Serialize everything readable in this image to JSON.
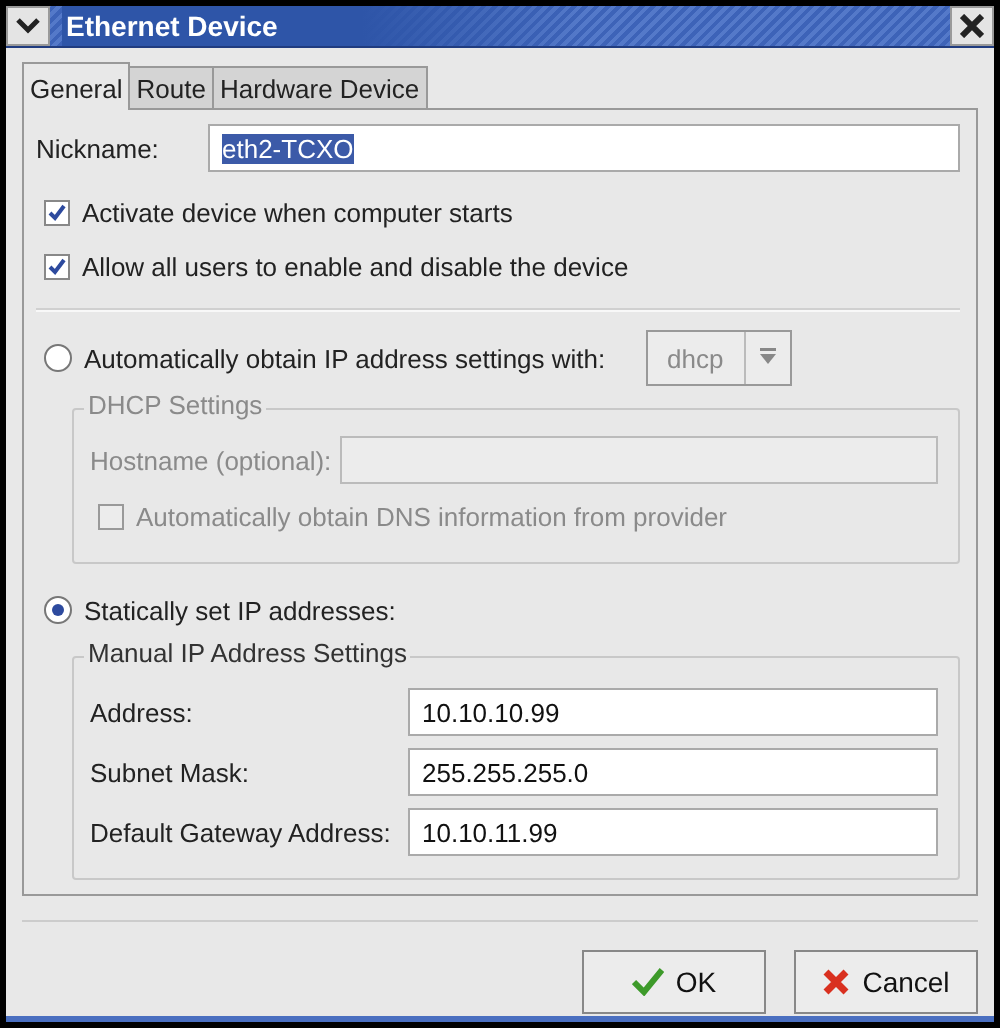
{
  "window": {
    "title": "Ethernet Device"
  },
  "tabs": [
    {
      "label": "General",
      "selected": true
    },
    {
      "label": "Route",
      "selected": false
    },
    {
      "label": "Hardware Device",
      "selected": false
    }
  ],
  "nickname": {
    "label": "Nickname:",
    "value": "eth2-TCXO",
    "text_selected": true
  },
  "options": [
    {
      "label": "Activate device when computer starts",
      "checked": true
    },
    {
      "label": "Allow all users to enable and disable the device",
      "checked": true
    }
  ],
  "automatic": {
    "label": "Automatically obtain IP address settings with:",
    "selected": false,
    "dropdown": {
      "value": "dhcp",
      "disabled": true
    }
  },
  "dhcp_settings": {
    "title": "DHCP Settings",
    "disabled": true,
    "hostname": {
      "label": "Hostname (optional):"
    },
    "dns": {
      "label": "Automatically obtain DNS information from provider",
      "checked": false
    }
  },
  "static": {
    "label": "Statically set IP addresses:",
    "selected": true
  },
  "manual_settings": {
    "title": "Manual IP Address Settings",
    "fields": [
      {
        "label": "Address:",
        "value": "10.10.10.99"
      },
      {
        "label": "Subnet Mask:",
        "value": "255.255.255.0"
      },
      {
        "label": "Default Gateway Address:",
        "value": "10.10.11.99"
      }
    ]
  },
  "buttons": [
    {
      "kind": "ok",
      "label": "OK"
    },
    {
      "kind": "cancel",
      "label": "Cancel"
    }
  ]
}
